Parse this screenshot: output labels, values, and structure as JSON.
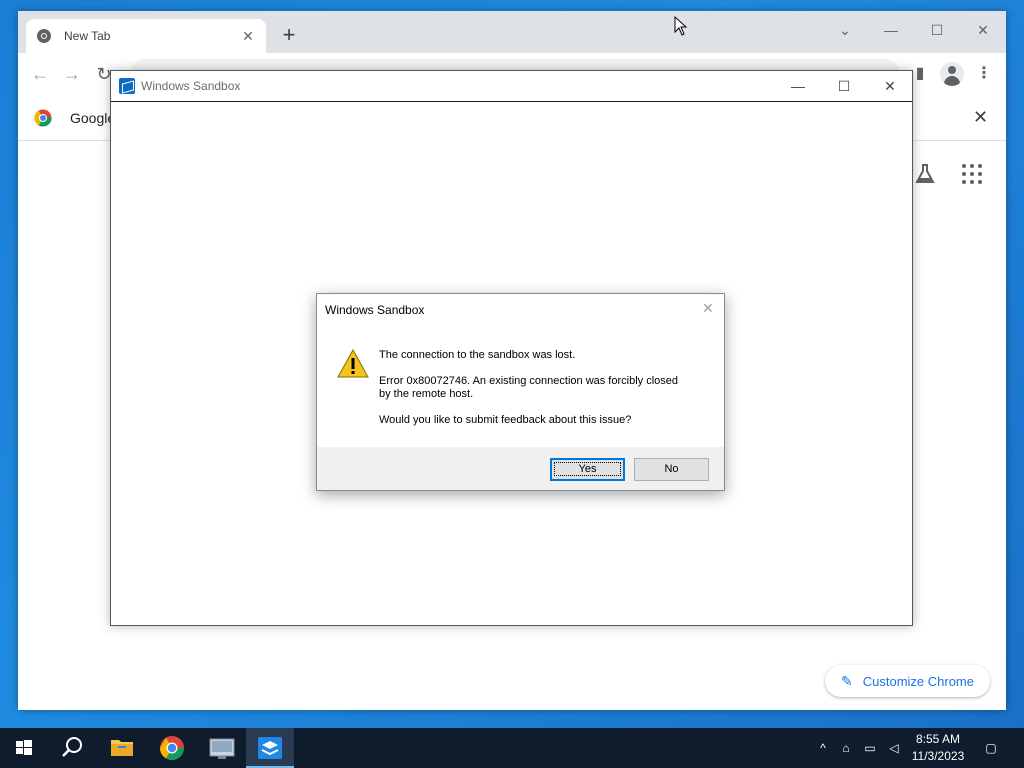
{
  "chrome": {
    "tab_title": "New Tab",
    "infobar_text": "Google",
    "customize_label": "Customize Chrome",
    "icons": [
      "chrome-favicon",
      "close-icon",
      "plus-icon",
      "minimize-icon",
      "maximize-icon",
      "close-window-icon",
      "back-icon",
      "forward-icon",
      "reload-icon",
      "side-panel-icon",
      "profile-icon",
      "more-icon",
      "labs-icon",
      "apps-grid-icon",
      "pencil-icon"
    ]
  },
  "sandbox": {
    "window_title": "Windows Sandbox"
  },
  "dialog": {
    "title": "Windows Sandbox",
    "message_main": "The connection to the sandbox was lost.",
    "error_line1": "Error 0x80072746. An existing connection was forcibly closed",
    "error_line2": "by the remote host.",
    "question": "Would you like to submit feedback about this issue?",
    "yes_label": "Yes",
    "no_label": "No"
  },
  "taskbar": {
    "time": "8:55 AM",
    "date": "11/3/2023",
    "pinned": [
      "start-icon",
      "search-icon",
      "file-explorer-icon",
      "chrome-icon",
      "sandbox-app-icon",
      "windows-sandbox-icon"
    ]
  },
  "colors": {
    "desktop": "#1a7fd6",
    "accent": "#1a73e8",
    "taskbar": "#0f1c2e"
  }
}
